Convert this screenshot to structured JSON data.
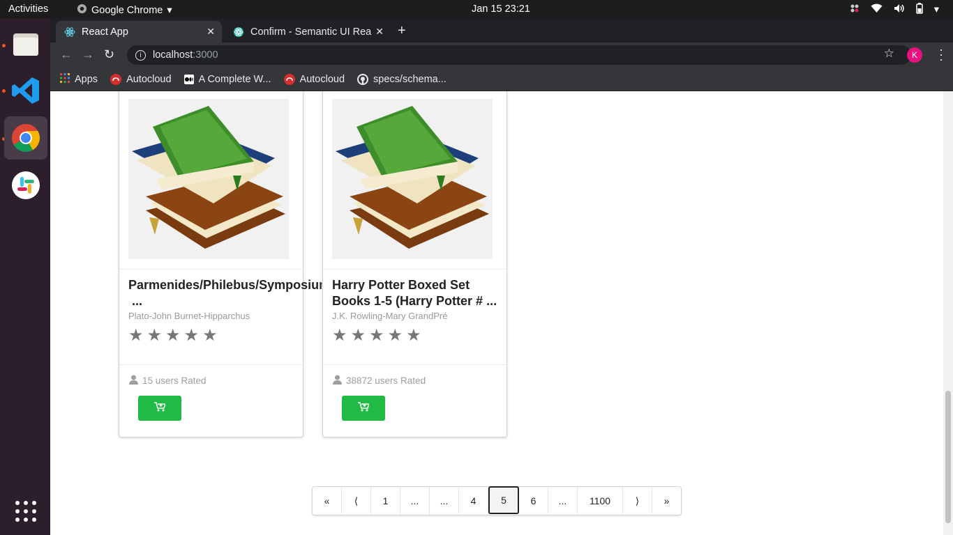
{
  "system": {
    "activities": "Activities",
    "app_name": "Google Chrome",
    "clock": "Jan 15  23:21"
  },
  "browser": {
    "tabs": [
      {
        "title": "React App"
      },
      {
        "title": "Confirm - Semantic UI Rea"
      }
    ],
    "url_host": "localhost",
    "url_port": ":3000",
    "profile_initial": "K",
    "bookmarks": [
      {
        "label": "Apps"
      },
      {
        "label": "Autocloud"
      },
      {
        "label": "A Complete W..."
      },
      {
        "label": "Autocloud"
      },
      {
        "label": "specs/schema..."
      }
    ]
  },
  "books": [
    {
      "title": "Parmenides/Philebus/Symposium/",
      "title_line2": "...",
      "author": "Plato-John Burnet-Hipparchus",
      "rating": 5,
      "rated_text": "15 users Rated"
    },
    {
      "title": "Harry Potter Boxed Set",
      "title_line2": "Books 1-5 (Harry Potter #  ...",
      "author": "J.K. Rowling-Mary GrandPré",
      "rating": 5,
      "rated_text": "38872 users Rated"
    }
  ],
  "pagination": {
    "first": "«",
    "prev": "⟨",
    "p1": "1",
    "e1": "...",
    "e2": "...",
    "p4": "4",
    "p5": "5",
    "p6": "6",
    "e3": "...",
    "last_num": "1100",
    "next": "⟩",
    "last": "»",
    "active_page": "5"
  },
  "colors": {
    "cart_button": "#21ba45",
    "dock_bg": "#2c1f2b",
    "avatar": "#e8117f"
  }
}
